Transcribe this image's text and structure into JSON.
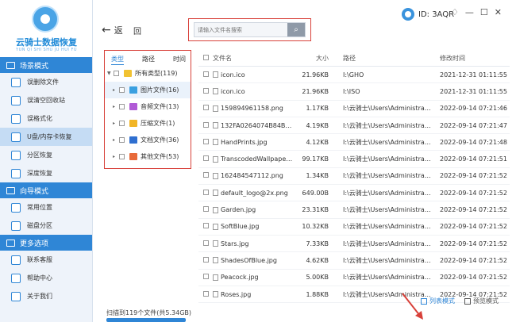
{
  "app": {
    "title": "云骑士数据恢复",
    "subtitle": "YUN QI SHI SHU JU HUI FU",
    "user_id": "ID: 3AQR"
  },
  "window_controls": [
    "♢",
    "—",
    "☐",
    "✕"
  ],
  "sidebar": {
    "sections": [
      {
        "label": "场景模式",
        "items": [
          {
            "label": "误删除文件",
            "active": false
          },
          {
            "label": "误清空回收站",
            "active": false
          },
          {
            "label": "误格式化",
            "active": false
          },
          {
            "label": "U盘/内存卡恢复",
            "active": true
          },
          {
            "label": "分区恢复",
            "active": false
          },
          {
            "label": "深度恢复",
            "active": false
          }
        ]
      },
      {
        "label": "向导模式",
        "items": [
          {
            "label": "常用位置",
            "active": false
          },
          {
            "label": "磁盘分区",
            "active": false
          }
        ]
      },
      {
        "label": "更多选项",
        "items": [
          {
            "label": "联系客服",
            "active": false
          },
          {
            "label": "帮助中心",
            "active": false
          },
          {
            "label": "关于我们",
            "active": false
          }
        ]
      }
    ]
  },
  "toolbar": {
    "back_label": "返",
    "home_label": "回",
    "search_placeholder": "请输入文件名搜索"
  },
  "type_panel": {
    "tabs": [
      "类型",
      "路径",
      "时间"
    ],
    "root": "所有类型(119)",
    "items": [
      {
        "label": "图片文件(16)",
        "color": "#3aa0e0",
        "highlight": true
      },
      {
        "label": "音频文件(13)",
        "color": "#b05ad6",
        "highlight": false
      },
      {
        "label": "压缩文件(1)",
        "color": "#f1b526",
        "highlight": false
      },
      {
        "label": "文档文件(36)",
        "color": "#2f6fd0",
        "highlight": false
      },
      {
        "label": "其他文件(53)",
        "color": "#e86a3a",
        "highlight": false
      }
    ]
  },
  "table": {
    "headers": [
      "文件名",
      "大小",
      "路径",
      "修改时间"
    ],
    "rows": [
      {
        "name": "icon.ico",
        "size": "21.96KB",
        "path": "I:\\GHO",
        "time": "2021-12-31 01:11:55"
      },
      {
        "name": "icon.ico",
        "size": "21.96KB",
        "path": "I:\\ISO",
        "time": "2021-12-31 01:11:55"
      },
      {
        "name": "159894961158.png",
        "size": "1.17KB",
        "path": "I:\\云骑士\\Users\\Administrator\\Ap...",
        "time": "2022-09-14 07:21:46"
      },
      {
        "name": "132FA0264074B84BF67...",
        "size": "4.19KB",
        "path": "I:\\云骑士\\Users\\Administrator\\Ap...",
        "time": "2022-09-14 07:21:47"
      },
      {
        "name": "HandPrints.jpg",
        "size": "4.12KB",
        "path": "I:\\云骑士\\Users\\Administrator\\Ap...",
        "time": "2022-09-14 07:21:48"
      },
      {
        "name": "TranscodedWallpaper.j...",
        "size": "99.17KB",
        "path": "I:\\云骑士\\Users\\Administrator\\Ap...",
        "time": "2022-09-14 07:21:51"
      },
      {
        "name": "162484547112.png",
        "size": "1.34KB",
        "path": "I:\\云骑士\\Users\\Administrator\\Ap...",
        "time": "2022-09-14 07:21:52"
      },
      {
        "name": "default_logo@2x.png",
        "size": "649.00B",
        "path": "I:\\云骑士\\Users\\Administrator\\Ap...",
        "time": "2022-09-14 07:21:52"
      },
      {
        "name": "Garden.jpg",
        "size": "23.31KB",
        "path": "I:\\云骑士\\Users\\Administrator\\Ap...",
        "time": "2022-09-14 07:21:52"
      },
      {
        "name": "SoftBlue.jpg",
        "size": "10.32KB",
        "path": "I:\\云骑士\\Users\\Administrator\\Ap...",
        "time": "2022-09-14 07:21:52"
      },
      {
        "name": "Stars.jpg",
        "size": "7.33KB",
        "path": "I:\\云骑士\\Users\\Administrator\\Ap...",
        "time": "2022-09-14 07:21:52"
      },
      {
        "name": "ShadesOfBlue.jpg",
        "size": "4.62KB",
        "path": "I:\\云骑士\\Users\\Administrator\\Ap...",
        "time": "2022-09-14 07:21:52"
      },
      {
        "name": "Peacock.jpg",
        "size": "5.00KB",
        "path": "I:\\云骑士\\Users\\Administrator\\Ap...",
        "time": "2022-09-14 07:21:52"
      },
      {
        "name": "Roses.jpg",
        "size": "1.88KB",
        "path": "I:\\云骑士\\Users\\Administrator\\Ap...",
        "time": "2022-09-14 07:21:52"
      }
    ]
  },
  "footer": {
    "scan_info": "扫描到119个文件(共5.34GB)",
    "list_view": "列表模式",
    "preview_view": "预览模式"
  }
}
